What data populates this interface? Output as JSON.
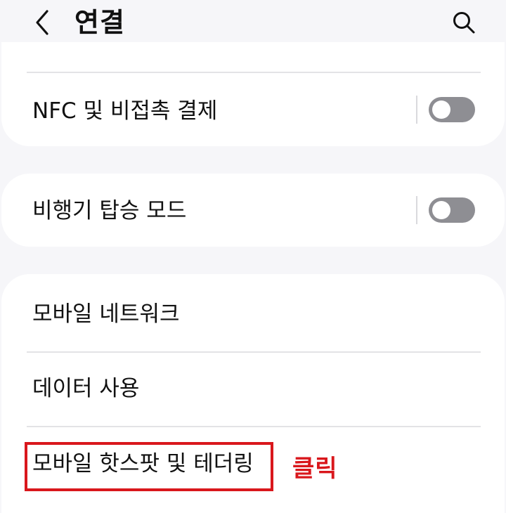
{
  "header": {
    "title": "연결",
    "back_icon": "chevron-left-icon",
    "search_icon": "search-icon"
  },
  "settings": {
    "nfc": {
      "label": "NFC 및 비접촉 결제",
      "toggle_on": false
    },
    "airplane": {
      "label": "비행기 탑승 모드",
      "toggle_on": false
    },
    "mobile_network": {
      "label": "모바일 네트워크"
    },
    "data_usage": {
      "label": "데이터 사용"
    },
    "hotspot": {
      "label": "모바일 핫스팟 및 테더링"
    }
  },
  "annotation": {
    "note": "클릭",
    "color": "#d9171c"
  },
  "colors": {
    "background": "#f6f6f9",
    "card": "#ffffff",
    "toggle_off": "#8e8e93"
  }
}
